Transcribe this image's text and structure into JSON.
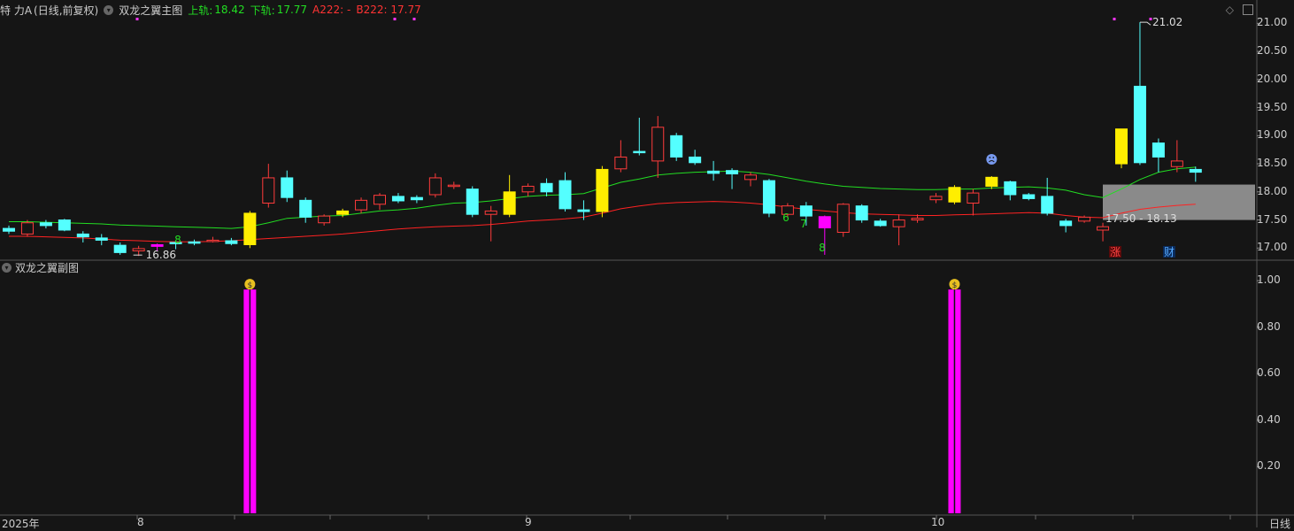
{
  "header": {
    "stock_name": "特 力A",
    "period": "(日线,前复权)",
    "indicator_name": "双龙之翼主图",
    "upper_label": "上轨:",
    "upper_value": "18.42",
    "lower_label": "下轨:",
    "lower_value": "17.77",
    "a222": "A222: -",
    "b222": "B222: 17.77"
  },
  "sub_panel": {
    "title": "双龙之翼副图"
  },
  "annotations": {
    "high": "21.02",
    "low": "16.86",
    "range": "17.50 - 18.13",
    "zhang": "涨",
    "cai": "财",
    "count_6": "6",
    "count_7": "7",
    "count_8a": "8",
    "count_8b": "8"
  },
  "x_axis": {
    "year": "2025年",
    "m8": "8",
    "m9": "9",
    "m10": "10",
    "period_label": "日线"
  },
  "y_axis_main": [
    "21.00",
    "20.50",
    "20.00",
    "19.50",
    "19.00",
    "18.50",
    "18.00",
    "17.50",
    "17.00"
  ],
  "y_axis_sub": [
    "1.00",
    "0.80",
    "0.60",
    "0.40",
    "0.20"
  ],
  "colors": {
    "up": "#ff3b3b",
    "down": "#54ffff",
    "signal_yellow": "#ffee00",
    "signal_magenta": "#ff00ff",
    "green_line": "#22dd22",
    "red_line": "#ff2222",
    "band_fill": "#8a8a8a"
  },
  "chart_data": {
    "type": "candlestick",
    "ylim": [
      16.8,
      21.1
    ],
    "candles": [
      {
        "o": 17.35,
        "c": 17.3,
        "h": 17.4,
        "l": 17.25,
        "t": "down"
      },
      {
        "o": 17.25,
        "c": 17.45,
        "h": 17.5,
        "l": 17.2,
        "t": "up"
      },
      {
        "o": 17.45,
        "c": 17.4,
        "h": 17.5,
        "l": 17.35,
        "t": "down"
      },
      {
        "o": 17.5,
        "c": 17.32,
        "h": 17.52,
        "l": 17.3,
        "t": "down"
      },
      {
        "o": 17.25,
        "c": 17.2,
        "h": 17.3,
        "l": 17.1,
        "t": "down"
      },
      {
        "o": 17.18,
        "c": 17.14,
        "h": 17.25,
        "l": 17.05,
        "t": "down"
      },
      {
        "o": 17.05,
        "c": 16.92,
        "h": 17.1,
        "l": 16.88,
        "t": "down"
      },
      {
        "o": 16.95,
        "c": 16.99,
        "h": 17.04,
        "l": 16.86,
        "t": "up"
      },
      {
        "o": 17.03,
        "c": 17.06,
        "h": 17.08,
        "l": 16.95,
        "t": "magenta"
      },
      {
        "o": 17.1,
        "c": 17.08,
        "h": 17.12,
        "l": 16.98,
        "t": "down"
      },
      {
        "o": 17.1,
        "c": 17.11,
        "h": 17.15,
        "l": 17.05,
        "t": "down"
      },
      {
        "o": 17.12,
        "c": 17.14,
        "h": 17.2,
        "l": 17.1,
        "t": "up"
      },
      {
        "o": 17.13,
        "c": 17.08,
        "h": 17.18,
        "l": 17.05,
        "t": "down"
      },
      {
        "o": 17.06,
        "c": 17.62,
        "h": 17.66,
        "l": 17.0,
        "t": "yellow"
      },
      {
        "o": 17.8,
        "c": 18.25,
        "h": 18.5,
        "l": 17.72,
        "t": "up"
      },
      {
        "o": 18.25,
        "c": 17.9,
        "h": 18.38,
        "l": 17.82,
        "t": "down"
      },
      {
        "o": 17.85,
        "c": 17.55,
        "h": 17.9,
        "l": 17.45,
        "t": "down"
      },
      {
        "o": 17.45,
        "c": 17.57,
        "h": 17.6,
        "l": 17.4,
        "t": "up"
      },
      {
        "o": 17.6,
        "c": 17.66,
        "h": 17.7,
        "l": 17.55,
        "t": "yellow"
      },
      {
        "o": 17.68,
        "c": 17.85,
        "h": 17.9,
        "l": 17.62,
        "t": "up"
      },
      {
        "o": 17.78,
        "c": 17.94,
        "h": 17.98,
        "l": 17.68,
        "t": "up"
      },
      {
        "o": 17.92,
        "c": 17.84,
        "h": 17.98,
        "l": 17.8,
        "t": "down"
      },
      {
        "o": 17.86,
        "c": 17.9,
        "h": 17.94,
        "l": 17.8,
        "t": "down"
      },
      {
        "o": 17.95,
        "c": 18.25,
        "h": 18.33,
        "l": 17.9,
        "t": "up"
      },
      {
        "o": 18.1,
        "c": 18.12,
        "h": 18.18,
        "l": 18.05,
        "t": "up"
      },
      {
        "o": 18.05,
        "c": 17.6,
        "h": 18.1,
        "l": 17.55,
        "t": "down"
      },
      {
        "o": 17.6,
        "c": 17.66,
        "h": 17.75,
        "l": 17.12,
        "t": "up"
      },
      {
        "o": 17.6,
        "c": 18.0,
        "h": 18.3,
        "l": 17.55,
        "t": "yellow"
      },
      {
        "o": 18.0,
        "c": 18.1,
        "h": 18.15,
        "l": 17.92,
        "t": "up"
      },
      {
        "o": 18.15,
        "c": 18.0,
        "h": 18.24,
        "l": 17.92,
        "t": "down"
      },
      {
        "o": 18.2,
        "c": 17.7,
        "h": 18.35,
        "l": 17.65,
        "t": "down"
      },
      {
        "o": 17.68,
        "c": 17.65,
        "h": 17.85,
        "l": 17.5,
        "t": "down"
      },
      {
        "o": 17.65,
        "c": 18.4,
        "h": 18.46,
        "l": 17.55,
        "t": "yellow"
      },
      {
        "o": 18.41,
        "c": 18.62,
        "h": 18.92,
        "l": 18.35,
        "t": "up"
      },
      {
        "o": 18.71,
        "c": 18.72,
        "h": 19.32,
        "l": 18.65,
        "t": "down"
      },
      {
        "o": 18.55,
        "c": 19.15,
        "h": 19.35,
        "l": 18.25,
        "t": "up"
      },
      {
        "o": 19.0,
        "c": 18.62,
        "h": 19.05,
        "l": 18.55,
        "t": "down"
      },
      {
        "o": 18.62,
        "c": 18.52,
        "h": 18.75,
        "l": 18.48,
        "t": "down"
      },
      {
        "o": 18.37,
        "c": 18.33,
        "h": 18.55,
        "l": 18.2,
        "t": "down"
      },
      {
        "o": 18.38,
        "c": 18.32,
        "h": 18.42,
        "l": 18.05,
        "t": "down"
      },
      {
        "o": 18.22,
        "c": 18.3,
        "h": 18.35,
        "l": 18.1,
        "t": "up"
      },
      {
        "o": 18.2,
        "c": 17.62,
        "h": 18.23,
        "l": 17.55,
        "t": "down"
      },
      {
        "o": 17.6,
        "c": 17.75,
        "h": 17.8,
        "l": 17.56,
        "t": "up"
      },
      {
        "o": 17.75,
        "c": 17.57,
        "h": 17.82,
        "l": 17.4,
        "t": "down"
      },
      {
        "o": 17.56,
        "c": 17.36,
        "h": 17.58,
        "l": 16.88,
        "t": "magenta"
      },
      {
        "o": 17.28,
        "c": 17.78,
        "h": 17.8,
        "l": 17.2,
        "t": "up"
      },
      {
        "o": 17.75,
        "c": 17.5,
        "h": 17.78,
        "l": 17.45,
        "t": "down"
      },
      {
        "o": 17.48,
        "c": 17.4,
        "h": 17.52,
        "l": 17.38,
        "t": "down"
      },
      {
        "o": 17.38,
        "c": 17.5,
        "h": 17.6,
        "l": 17.05,
        "t": "up"
      },
      {
        "o": 17.5,
        "c": 17.53,
        "h": 17.6,
        "l": 17.45,
        "t": "up"
      },
      {
        "o": 17.86,
        "c": 17.92,
        "h": 17.98,
        "l": 17.8,
        "t": "up"
      },
      {
        "o": 17.82,
        "c": 18.08,
        "h": 18.12,
        "l": 17.78,
        "t": "yellow"
      },
      {
        "o": 17.8,
        "c": 17.98,
        "h": 18.05,
        "l": 17.58,
        "t": "up"
      },
      {
        "o": 18.1,
        "c": 18.26,
        "h": 18.28,
        "l": 18.05,
        "t": "yellow"
      },
      {
        "o": 18.18,
        "c": 17.95,
        "h": 18.2,
        "l": 17.85,
        "t": "down"
      },
      {
        "o": 17.95,
        "c": 17.88,
        "h": 17.98,
        "l": 17.85,
        "t": "down"
      },
      {
        "o": 17.92,
        "c": 17.62,
        "h": 18.25,
        "l": 17.58,
        "t": "down"
      },
      {
        "o": 17.48,
        "c": 17.4,
        "h": 17.52,
        "l": 17.28,
        "t": "down"
      },
      {
        "o": 17.48,
        "c": 17.55,
        "h": 17.58,
        "l": 17.45,
        "t": "up"
      },
      {
        "o": 17.32,
        "c": 17.38,
        "h": 17.45,
        "l": 17.12,
        "t": "up"
      },
      {
        "o": 18.5,
        "c": 19.12,
        "h": 19.12,
        "l": 18.42,
        "t": "yellow"
      },
      {
        "o": 19.88,
        "c": 18.52,
        "h": 21.02,
        "l": 18.48,
        "t": "down"
      },
      {
        "o": 18.87,
        "c": 18.62,
        "h": 18.95,
        "l": 18.35,
        "t": "down"
      },
      {
        "o": 18.45,
        "c": 18.55,
        "h": 18.92,
        "l": 18.35,
        "t": "up"
      },
      {
        "o": 18.4,
        "c": 18.35,
        "h": 18.45,
        "l": 18.18,
        "t": "down"
      }
    ],
    "green_line": [
      17.47,
      17.47,
      17.46,
      17.45,
      17.44,
      17.43,
      17.41,
      17.4,
      17.39,
      17.38,
      17.37,
      17.36,
      17.35,
      17.38,
      17.45,
      17.53,
      17.55,
      17.57,
      17.58,
      17.62,
      17.66,
      17.68,
      17.71,
      17.76,
      17.8,
      17.81,
      17.84,
      17.88,
      17.92,
      17.94,
      17.95,
      17.97,
      18.07,
      18.17,
      18.23,
      18.3,
      18.33,
      18.35,
      18.36,
      18.37,
      18.35,
      18.31,
      18.25,
      18.19,
      18.14,
      18.1,
      18.08,
      18.06,
      18.05,
      18.04,
      18.04,
      18.05,
      18.05,
      18.07,
      18.08,
      18.09,
      18.07,
      18.03,
      17.95,
      17.9,
      18.05,
      18.22,
      18.35,
      18.41,
      18.44
    ],
    "red_line": [
      17.21,
      17.21,
      17.2,
      17.19,
      17.18,
      17.16,
      17.14,
      17.13,
      17.12,
      17.11,
      17.11,
      17.12,
      17.13,
      17.15,
      17.17,
      17.19,
      17.21,
      17.23,
      17.25,
      17.28,
      17.31,
      17.34,
      17.36,
      17.38,
      17.39,
      17.4,
      17.42,
      17.45,
      17.48,
      17.5,
      17.52,
      17.55,
      17.62,
      17.7,
      17.75,
      17.79,
      17.81,
      17.82,
      17.83,
      17.82,
      17.8,
      17.77,
      17.73,
      17.69,
      17.66,
      17.63,
      17.61,
      17.6,
      17.59,
      17.58,
      17.58,
      17.59,
      17.6,
      17.61,
      17.62,
      17.63,
      17.62,
      17.58,
      17.55,
      17.54,
      17.62,
      17.69,
      17.73,
      17.76,
      17.78
    ],
    "band": {
      "lower": 17.5,
      "upper": 18.13
    },
    "sub_signals": [
      {
        "index": 13,
        "value": 1.0
      },
      {
        "index": 51,
        "value": 1.0
      }
    ],
    "sub_ylim": [
      0,
      1.05
    ]
  }
}
